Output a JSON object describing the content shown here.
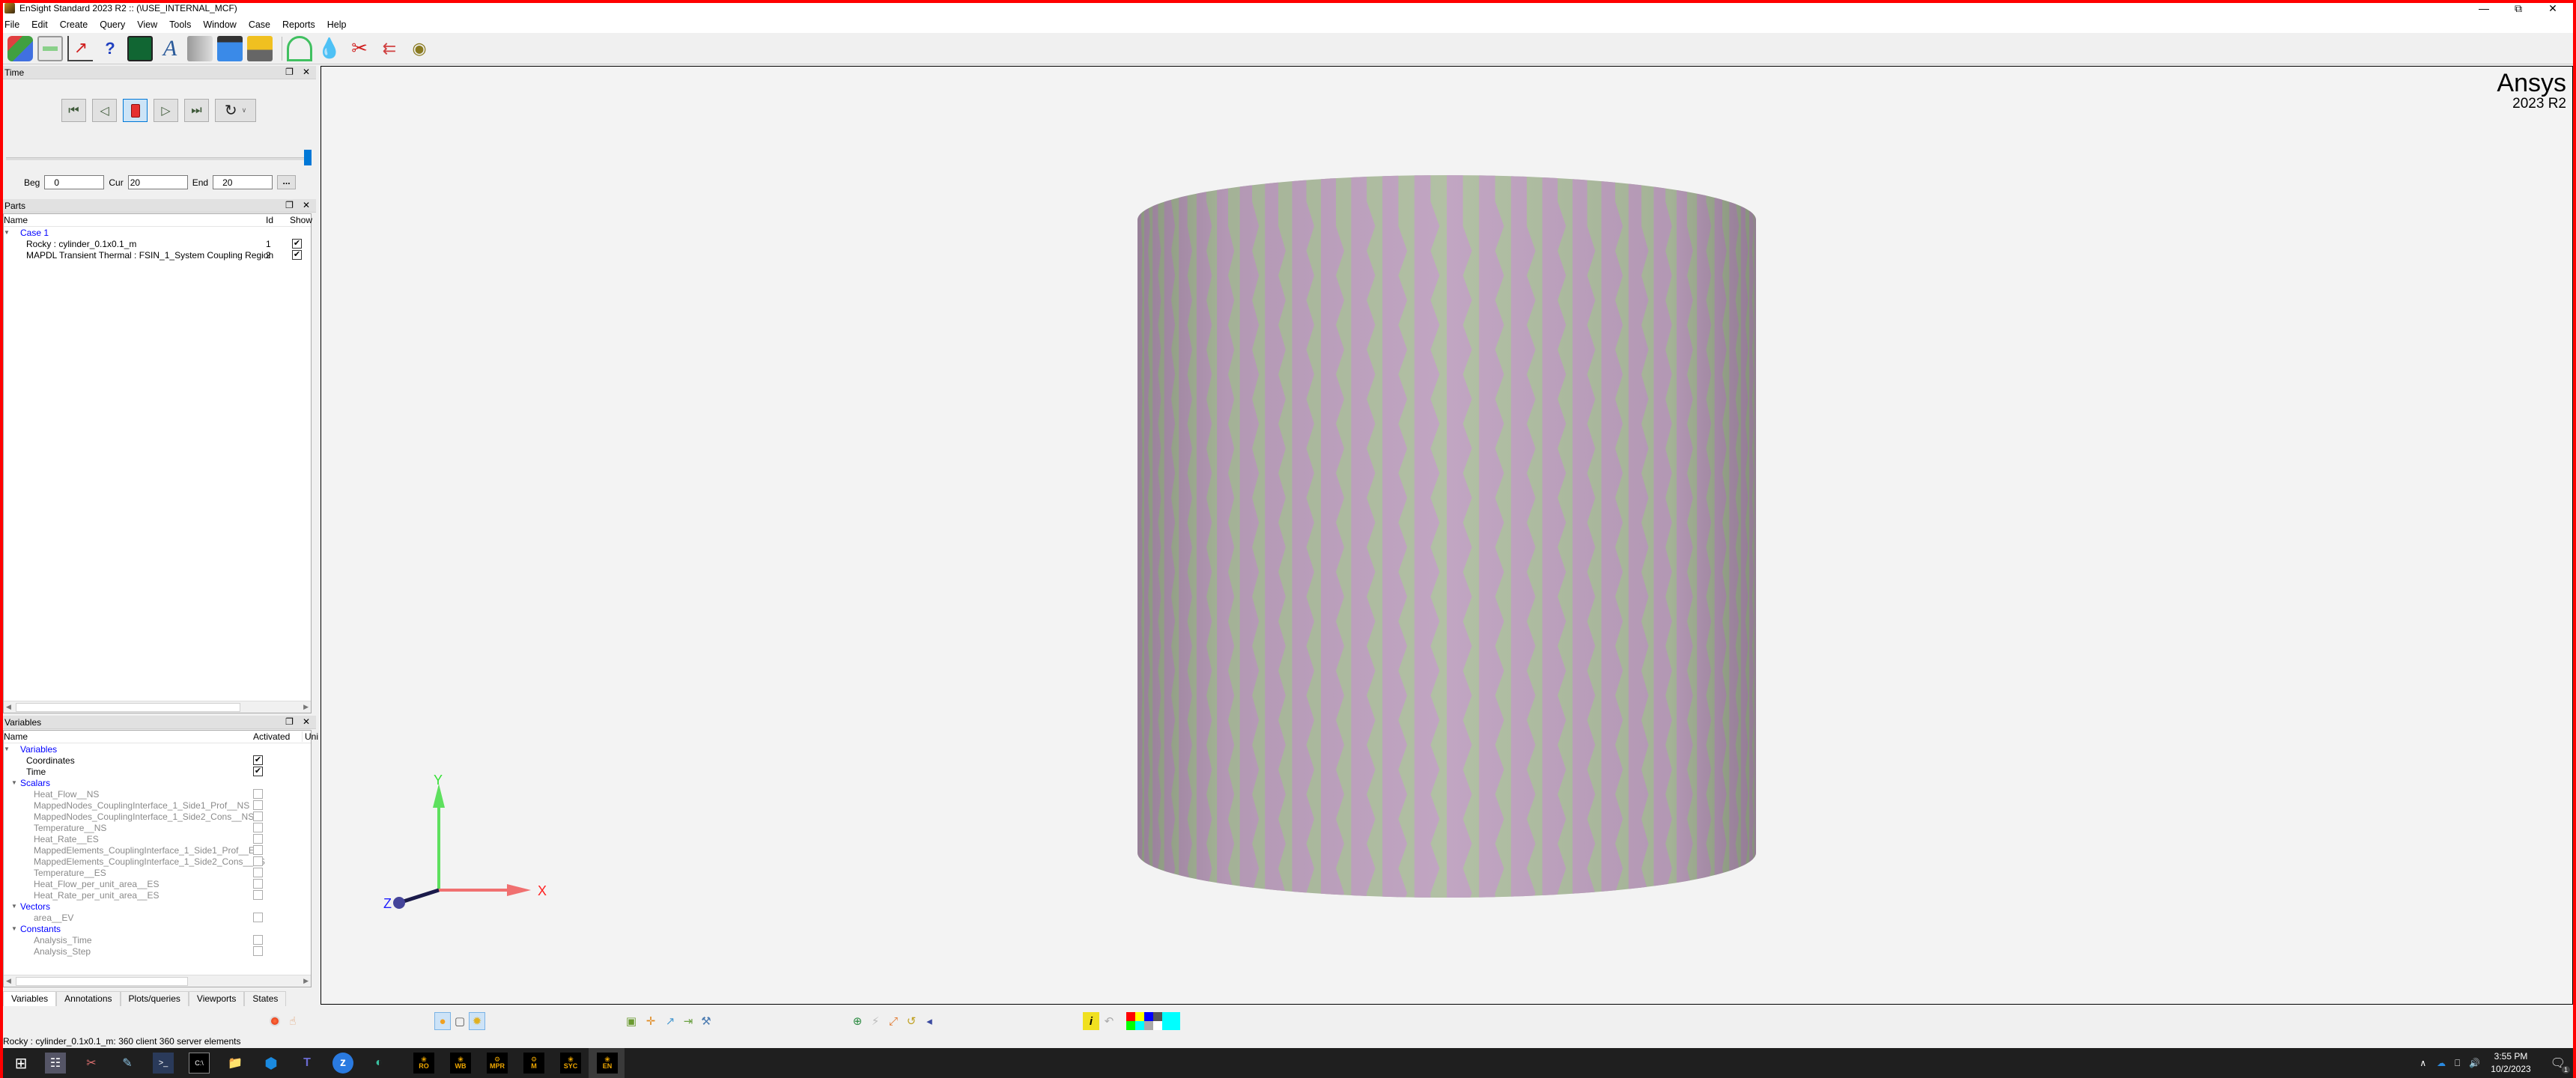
{
  "window": {
    "title": "EnSight Standard 2023 R2 ::  (\\USE_INTERNAL_MCF)",
    "controls": [
      "minimize",
      "restore",
      "close"
    ]
  },
  "menu": [
    "File",
    "Edit",
    "Create",
    "Query",
    "View",
    "Tools",
    "Window",
    "Case",
    "Reports",
    "Help"
  ],
  "toolbar": {
    "icons": [
      "parts-puzzle-icon",
      "calculator-icon",
      "plot-icon",
      "query-probe-icon",
      "viewports-icon",
      "annotation-text-icon",
      "flipbook-icon",
      "animation-clapper-icon",
      "toolbox-icon",
      "contour-icon",
      "isosurface-drops-icon",
      "clip-scissors-icon",
      "vector-arrows-icon",
      "particle-trace-icon"
    ]
  },
  "time_panel": {
    "title": "Time",
    "buttons": [
      "first-step",
      "step-back",
      "stop",
      "play",
      "last-step",
      "loop"
    ],
    "slider_fraction": 1.0,
    "beg_label": "Beg",
    "beg_value": "0",
    "cur_label": "Cur",
    "cur_value": "20",
    "end_label": "End",
    "end_value": "20",
    "more_label": "..."
  },
  "parts_panel": {
    "title": "Parts",
    "columns": [
      "Name",
      "Id",
      "Show"
    ],
    "case_label": "Case 1",
    "rows": [
      {
        "name": "Rocky : cylinder_0.1x0.1_m",
        "id": "1",
        "show": true
      },
      {
        "name": "MAPDL Transient Thermal : FSIN_1_System Coupling Region",
        "id": "2",
        "show": true
      }
    ]
  },
  "variables_panel": {
    "title": "Variables",
    "columns": [
      "Name",
      "Activated",
      "Uni"
    ],
    "groups": [
      {
        "label": "Variables",
        "items": [
          {
            "name": "Coordinates",
            "activated": true,
            "enabled": true
          },
          {
            "name": "Time",
            "activated": true,
            "enabled": true
          }
        ]
      },
      {
        "label": "Scalars",
        "items": [
          {
            "name": "Heat_Flow__NS",
            "activated": false,
            "enabled": false
          },
          {
            "name": "MappedNodes_CouplingInterface_1_Side1_Prof__NS",
            "activated": false,
            "enabled": false
          },
          {
            "name": "MappedNodes_CouplingInterface_1_Side2_Cons__NS",
            "activated": false,
            "enabled": false
          },
          {
            "name": "Temperature__NS",
            "activated": false,
            "enabled": false
          },
          {
            "name": "Heat_Rate__ES",
            "activated": false,
            "enabled": false
          },
          {
            "name": "MappedElements_CouplingInterface_1_Side1_Prof__ES",
            "activated": false,
            "enabled": false
          },
          {
            "name": "MappedElements_CouplingInterface_1_Side2_Cons__ES",
            "activated": false,
            "enabled": false
          },
          {
            "name": "Temperature__ES",
            "activated": false,
            "enabled": false
          },
          {
            "name": "Heat_Flow_per_unit_area__ES",
            "activated": false,
            "enabled": false
          },
          {
            "name": "Heat_Rate_per_unit_area__ES",
            "activated": false,
            "enabled": false
          }
        ]
      },
      {
        "label": "Vectors",
        "items": [
          {
            "name": "area__EV",
            "activated": false,
            "enabled": false
          }
        ]
      },
      {
        "label": "Constants",
        "items": [
          {
            "name": "Analysis_Time",
            "activated": false,
            "enabled": false
          },
          {
            "name": "Analysis_Step",
            "activated": false,
            "enabled": false
          }
        ]
      }
    ]
  },
  "bottom_tabs": [
    "Variables",
    "Annotations",
    "Plots/queries",
    "Viewports",
    "States"
  ],
  "active_tab": "Variables",
  "viewport": {
    "brand": "Ansys",
    "version": "2023 R2",
    "axis_labels": {
      "x": "X",
      "y": "Y",
      "z": "Z"
    },
    "colors": {
      "pink": "#bea1bf",
      "green": "#aebda0",
      "x_axis": "#f07070",
      "y_axis": "#5ee05e",
      "z_axis": "#1a1a4a"
    }
  },
  "bottom_toolbar": {
    "left_icons": [
      "record-icon",
      "pick-hand-icon"
    ],
    "mode_icons": [
      "light-source-icon",
      "wireframe-box-icon",
      "selection-highlight-icon"
    ],
    "transform_icons": [
      "zoom-region-icon",
      "translate-icon",
      "rotate-arrow-icon",
      "fit-icon",
      "transform-tools-icon"
    ],
    "view_icons": [
      "rotate-view-icon",
      "lightning-icon",
      "scale-icon",
      "undo-view-icon",
      "eye-view-icon"
    ],
    "info_icons": [
      "info-icon",
      "undo-icon"
    ],
    "palette": [
      "#ff0000",
      "#ffff00",
      "#0000ff",
      "#555555",
      "#00ff00",
      "#00ffff",
      "#aaaaaa",
      "#ffffff",
      "#00ffff"
    ]
  },
  "status_bar": "Rocky : cylinder_0.1x0.1_m: 360 client 360 server elements",
  "taskbar": {
    "apps": [
      "start",
      "calculator",
      "snipping-tool",
      "notepad",
      "powershell",
      "cmd",
      "file-explorer",
      "vscode",
      "teams",
      "zoom",
      "edge"
    ],
    "ansys_apps": [
      "RO",
      "WB",
      "MPR",
      "M",
      "SYC",
      "EN"
    ],
    "time": "3:55 PM",
    "date": "10/2/2023",
    "notification_count": "1"
  }
}
